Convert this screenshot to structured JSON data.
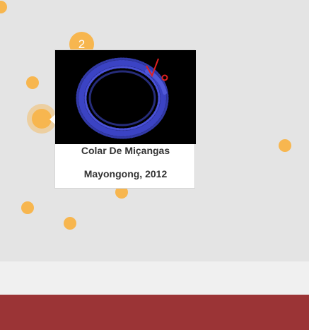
{
  "map": {
    "cluster_count": "2",
    "marker_color": "#f7b64f"
  },
  "popup": {
    "title": "Colar De Miçangas",
    "subtitle": "Mayongong, 2012",
    "image_alt": "blue beaded necklace on black background"
  },
  "footer": {
    "color": "#9b3436"
  }
}
